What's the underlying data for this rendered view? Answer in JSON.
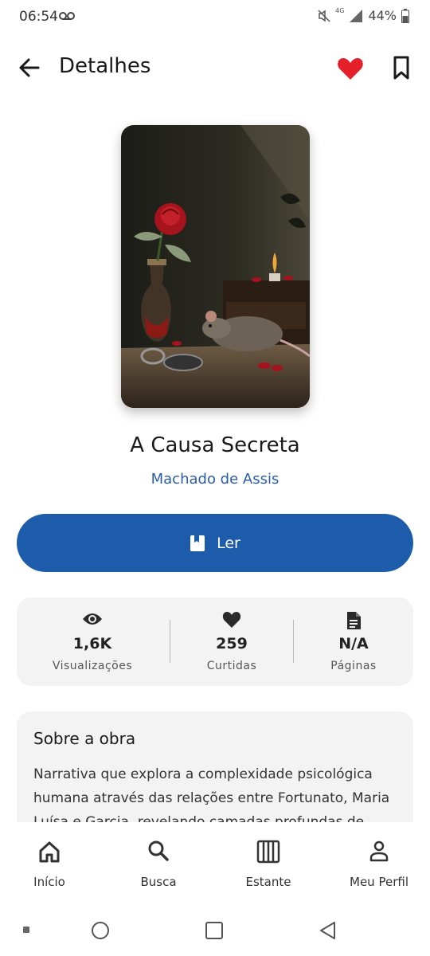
{
  "status_bar": {
    "time": "06:54",
    "network": "4G",
    "battery": "44%"
  },
  "app_bar": {
    "title": "Detalhes"
  },
  "book": {
    "title": "A Causa Secreta",
    "author": "Machado de Assis"
  },
  "read_button": {
    "label": "Ler"
  },
  "stats": [
    {
      "icon": "eye-icon",
      "value": "1,6K",
      "label": "Visualizações"
    },
    {
      "icon": "heart-icon",
      "value": "259",
      "label": "Curtidas"
    },
    {
      "icon": "document-icon",
      "value": "N/A",
      "label": "Páginas"
    }
  ],
  "about": {
    "title": "Sobre a obra",
    "text": "Narrativa que explora a complexidade psicológica humana através das relações entre Fortunato, Maria Luísa e Garcia, revelando camadas profundas de"
  },
  "bottom_nav": [
    {
      "icon": "home-icon",
      "label": "Início"
    },
    {
      "icon": "search-icon",
      "label": "Busca"
    },
    {
      "icon": "bookshelf-icon",
      "label": "Estante"
    },
    {
      "icon": "person-icon",
      "label": "Meu Perfil"
    }
  ],
  "colors": {
    "accent": "#1c5cab",
    "favorite": "#e5202a",
    "card_bg": "#f3f3f4"
  }
}
